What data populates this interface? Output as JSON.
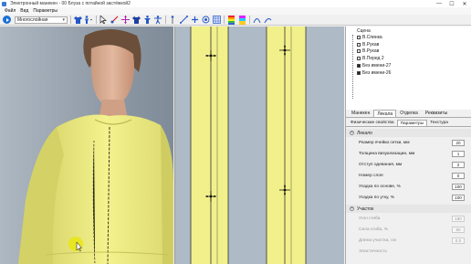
{
  "window": {
    "title": "Электронный манекен - 00 Блуза с потайной застёжкой2",
    "minimize": "—",
    "maximize": "☐",
    "close": "✕"
  },
  "menu": {
    "file": "Файл",
    "view": "Вид",
    "params": "Параметры"
  },
  "toolbar": {
    "mode_value": "Многослойная",
    "mode_chevron": "▾"
  },
  "scene": {
    "header": "Сцена",
    "items": [
      {
        "label": "В.Спинка",
        "checked": false
      },
      {
        "label": "В.Рукав",
        "checked": false
      },
      {
        "label": "В.Рукав",
        "checked": false
      },
      {
        "label": "В.Перед 2",
        "checked": false
      },
      {
        "label": "Без имени-27",
        "checked": true
      },
      {
        "label": "Без имени-26",
        "checked": true
      }
    ]
  },
  "props": {
    "tabs": [
      "Манекен",
      "Лекала",
      "Отделка",
      "Реквизиты"
    ],
    "active_tab": 1,
    "subtabs": [
      "Физические свойства",
      "Параметры",
      "Текстура"
    ],
    "active_subtab": 1,
    "group_lekalo": "Лекало",
    "rows": [
      {
        "label": "Размер ячейки сетки, мм",
        "value": "20"
      },
      {
        "label": "Толщина визуализации, мм",
        "value": "1"
      },
      {
        "label": "Отступ одевания, мм",
        "value": "2"
      },
      {
        "label": "Номер слоя",
        "value": "0"
      },
      {
        "label": "Усадка по основе, %",
        "value": "100"
      },
      {
        "label": "Усадка по утку, %",
        "value": "100"
      }
    ],
    "group_uchastok": "Участок",
    "rows2": [
      {
        "label": "Угол сгиба",
        "value": "180"
      },
      {
        "label": "Сила сгиба, %",
        "value": "50"
      },
      {
        "label": "Длина участка, см",
        "value": "0.0"
      },
      {
        "label": "Эластичность",
        "value": ""
      }
    ]
  },
  "colors": {
    "fabric": "#f2f08a",
    "fabric_shadow": "#d9d66b",
    "accent": "#1d6fd8"
  }
}
